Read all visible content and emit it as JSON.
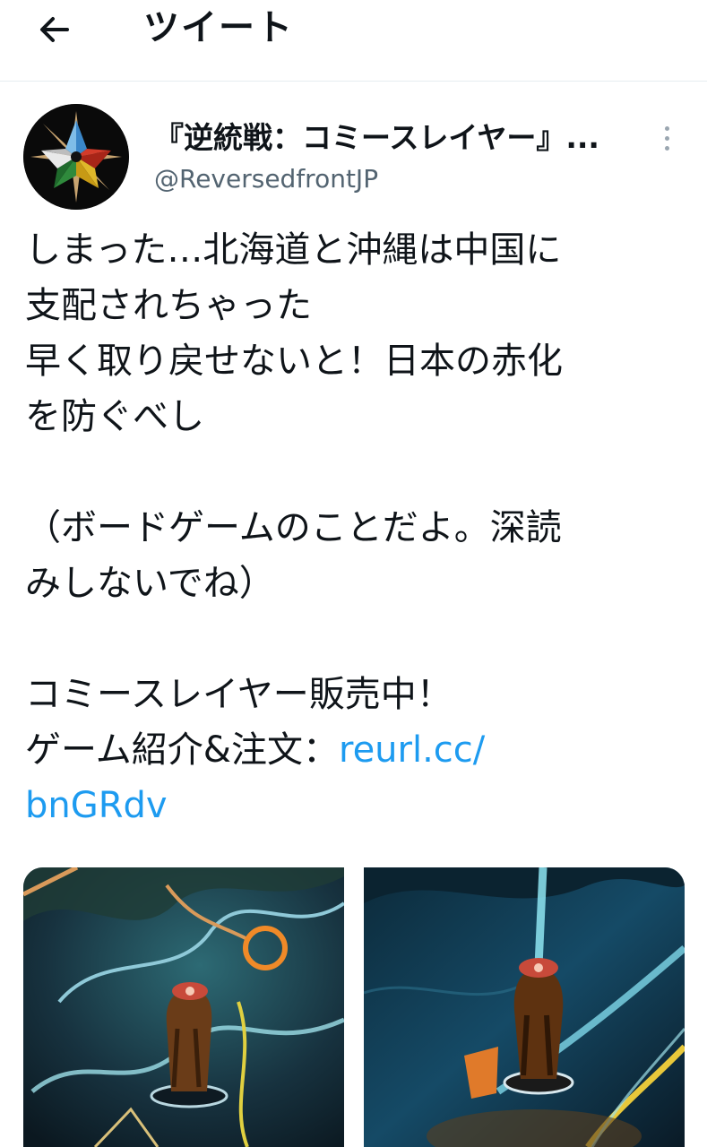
{
  "header": {
    "title": "ツイート",
    "back_icon": "arrow-left-icon"
  },
  "tweet": {
    "author": {
      "display_name": "『逆統戦：コミースレイヤー』...",
      "handle": "@ReversedfrontJP",
      "avatar_icon": "compass-star-avatar"
    },
    "more_icon": "more-vertical-icon",
    "text": {
      "line1": "しまった…北海道と沖縄は中国に",
      "line2": "支配されちゃった",
      "line3": "早く取り戻せないと！日本の赤化",
      "line4": "を防ぐべし",
      "line5": "（ボードゲームのことだよ。深読",
      "line6": "みしないでね）",
      "line7": "コミースレイヤー販売中！",
      "line8_prefix": "ゲーム紹介&注文：",
      "link_part1": "reurl.cc/",
      "link_part2": "bnGRdv"
    },
    "link_color": "#1d9bf0",
    "media": [
      {
        "name": "boardgame-photo-hokkaido-piece"
      },
      {
        "name": "boardgame-photo-okinawa-piece"
      }
    ]
  }
}
